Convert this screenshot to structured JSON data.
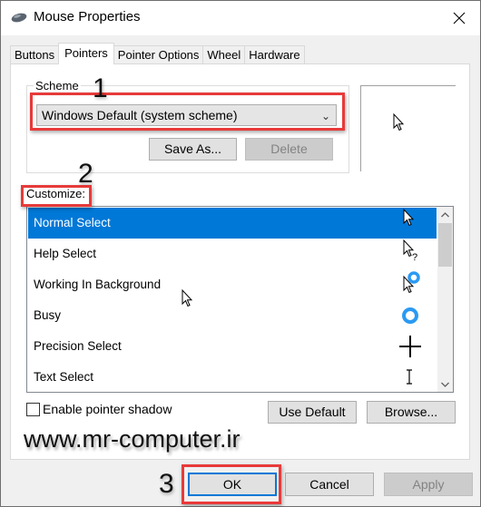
{
  "window": {
    "title": "Mouse Properties",
    "icon": "mouse-icon",
    "close_icon": "close-icon"
  },
  "tabs": [
    {
      "label": "Buttons",
      "active": false
    },
    {
      "label": "Pointers",
      "active": true
    },
    {
      "label": "Pointer Options",
      "active": false
    },
    {
      "label": "Wheel",
      "active": false
    },
    {
      "label": "Hardware",
      "active": false
    }
  ],
  "scheme": {
    "group_label": "Scheme",
    "selected": "Windows Default (system scheme)",
    "save_as_label": "Save As...",
    "delete_label": "Delete"
  },
  "customize": {
    "label": "Customize:",
    "items": [
      {
        "label": "Normal Select",
        "icon": "arrow-cursor-icon",
        "selected": true
      },
      {
        "label": "Help Select",
        "icon": "help-cursor-icon",
        "selected": false
      },
      {
        "label": "Working In Background",
        "icon": "working-cursor-icon",
        "selected": false
      },
      {
        "label": "Busy",
        "icon": "busy-cursor-icon",
        "selected": false
      },
      {
        "label": "Precision Select",
        "icon": "crosshair-cursor-icon",
        "selected": false
      },
      {
        "label": "Text Select",
        "icon": "text-cursor-icon",
        "selected": false
      }
    ]
  },
  "options": {
    "enable_shadow_label": "Enable pointer shadow",
    "enable_shadow_checked": false,
    "use_default_label": "Use Default",
    "browse_label": "Browse..."
  },
  "watermark": "www.mr-computer.ir",
  "dialog_buttons": {
    "ok_label": "OK",
    "cancel_label": "Cancel",
    "apply_label": "Apply"
  },
  "annotations": [
    "1",
    "2",
    "3"
  ],
  "colors": {
    "selection": "#0078d7",
    "annotation": "#e83a3a",
    "busy_ring": "#2b9af3"
  }
}
